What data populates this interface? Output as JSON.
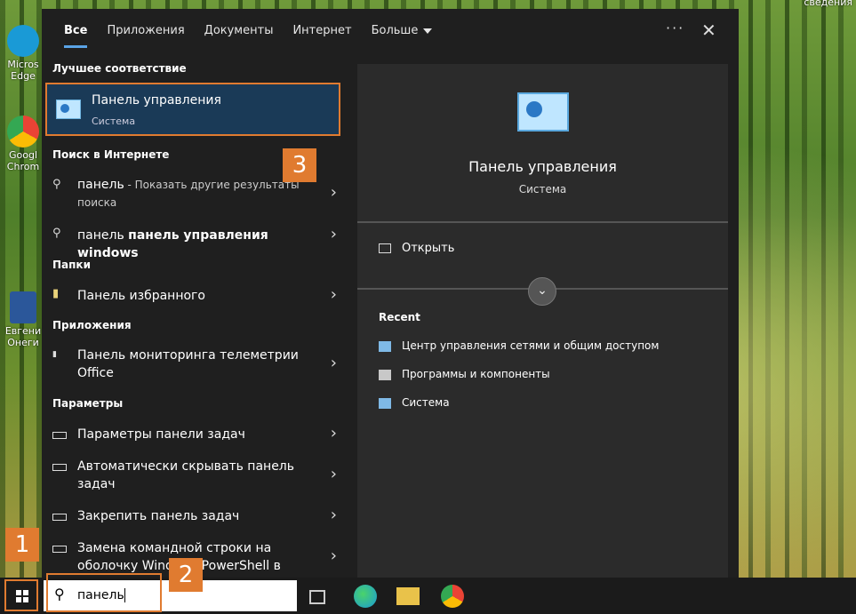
{
  "desktop": {
    "corner_text": "сведения",
    "icons": [
      {
        "label": "Micros Edge",
        "color": "#1a9ad6"
      },
      {
        "label": "Googl Chrom",
        "color": "#4285f4"
      },
      {
        "label": "Евгени Онеги",
        "color": "#2b579a"
      }
    ]
  },
  "tabs": [
    {
      "label": "Все"
    },
    {
      "label": "Приложения"
    },
    {
      "label": "Документы"
    },
    {
      "label": "Интернет"
    },
    {
      "label": "Больше"
    }
  ],
  "best_match": {
    "section": "Лучшее соответствие",
    "title": "Панель управления",
    "subtitle": "Система"
  },
  "web": {
    "section": "Поиск в Интернете",
    "items": [
      {
        "bold": "панель",
        "rest": " - Показать другие результаты поиска"
      },
      {
        "bold": "панель управления windows",
        "plain": "панель "
      }
    ]
  },
  "folders": {
    "section": "Папки",
    "items": [
      {
        "label": "Панель избранного"
      }
    ]
  },
  "apps": {
    "section": "Приложения",
    "items": [
      {
        "label": "Панель мониторинга телеметрии Office"
      }
    ]
  },
  "settings": {
    "section": "Параметры",
    "items": [
      {
        "label": "Параметры панели задач"
      },
      {
        "label": "Автоматически скрывать панель задач"
      },
      {
        "label": "Закрепить панель задач"
      },
      {
        "label": "Замена командной строки на оболочку Windows PowerShell в"
      }
    ]
  },
  "preview": {
    "title": "Панель управления",
    "subtitle": "Система",
    "open_label": "Открыть",
    "recent_header": "Recent",
    "recent": [
      {
        "label": "Центр управления сетями и общим доступом"
      },
      {
        "label": "Программы и компоненты"
      },
      {
        "label": "Система"
      }
    ]
  },
  "taskbar": {
    "search_value": "панель"
  },
  "badges": [
    "1",
    "2",
    "3"
  ],
  "accent_color": "#e07b30"
}
